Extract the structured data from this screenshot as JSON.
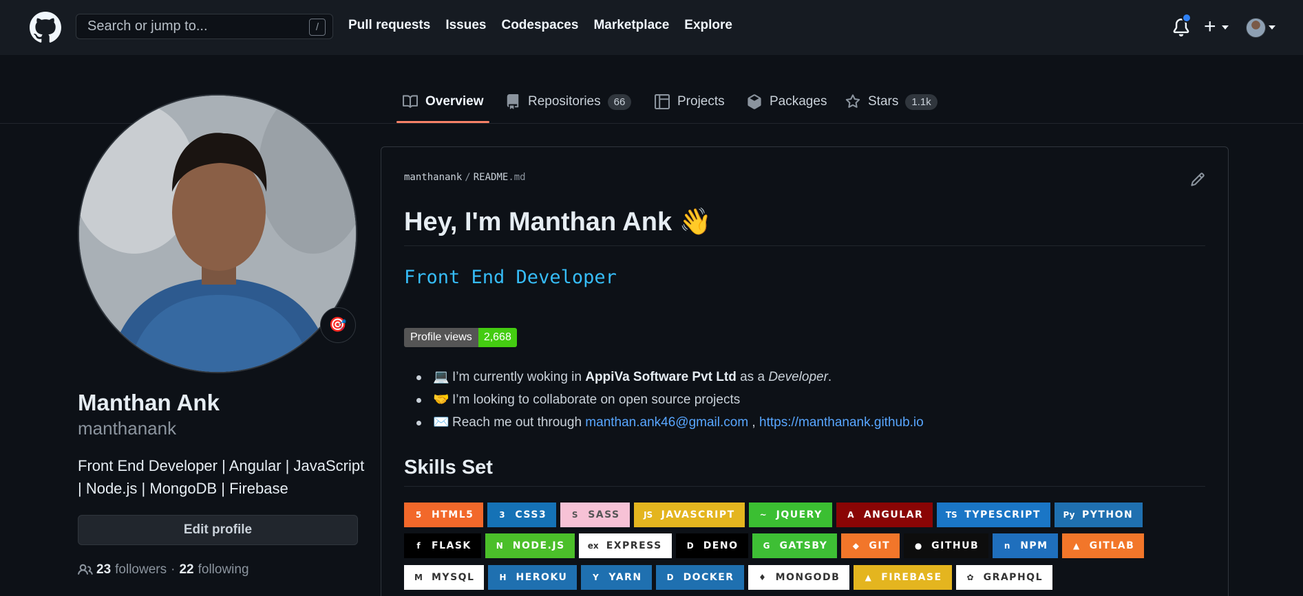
{
  "header": {
    "search_placeholder": "Search or jump to...",
    "search_shortcut": "/",
    "nav": [
      "Pull requests",
      "Issues",
      "Codespaces",
      "Marketplace",
      "Explore"
    ],
    "plus": "+"
  },
  "tabs": {
    "overview": "Overview",
    "repositories": "Repositories",
    "repositories_count": "66",
    "projects": "Projects",
    "packages": "Packages",
    "stars": "Stars",
    "stars_count": "1.1k"
  },
  "profile": {
    "name": "Manthan Ank",
    "login": "manthanank",
    "bio": "Front End Developer | Angular | JavaScript | Node.js | MongoDB | Firebase",
    "edit_button": "Edit profile",
    "followers_count": "23",
    "followers_label": "followers",
    "separator": "·",
    "following_count": "22",
    "following_label": "following",
    "status_emoji": "🎯"
  },
  "readme": {
    "owner": "manthanank",
    "file_base": "README",
    "file_ext": ".md",
    "heading": "Hey, I'm Manthan Ank",
    "heading_emoji": "👋",
    "typing_text": "Front End Developer",
    "views_label": "Profile views",
    "views_value": "2,668",
    "bullet1_emoji": "💻",
    "bullet1_pre": "I’m currently woking in ",
    "bullet1_company": "AppiVa Software Pvt Ltd",
    "bullet1_mid": " as a ",
    "bullet1_role": "Developer",
    "bullet1_end": ".",
    "bullet2_emoji": "🤝",
    "bullet2_text": "I’m looking to collaborate on open source projects",
    "bullet3_emoji": "✉️",
    "bullet3_pre": "Reach me out through ",
    "bullet3_email": "manthan.ank46@gmail.com",
    "bullet3_sep": " , ",
    "bullet3_url": "https://manthanank.github.io",
    "skills_heading": "Skills Set"
  },
  "skills": {
    "row1": [
      {
        "label": "HTML5",
        "bg": "#f2682a",
        "fg": "#ffffff",
        "icon": "5"
      },
      {
        "label": "CSS3",
        "bg": "#1572b6",
        "fg": "#ffffff",
        "icon": "3"
      },
      {
        "label": "SASS",
        "bg": "#f7c2d6",
        "fg": "#555555",
        "icon": "S"
      },
      {
        "label": "JAVASCRIPT",
        "bg": "#e4b51f",
        "fg": "#ffffff",
        "icon": "JS"
      },
      {
        "label": "JQUERY",
        "bg": "#3bbf32",
        "fg": "#ffffff",
        "icon": "~"
      },
      {
        "label": "ANGULAR",
        "bg": "#8a0505",
        "fg": "#ffffff",
        "icon": "A"
      },
      {
        "label": "TYPESCRIPT",
        "bg": "#1a76c6",
        "fg": "#ffffff",
        "icon": "TS"
      },
      {
        "label": "PYTHON",
        "bg": "#1f70b0",
        "fg": "#ffffff",
        "icon": "Py"
      }
    ],
    "row2": [
      {
        "label": "FLASK",
        "bg": "#000000",
        "fg": "#ffffff",
        "icon": "f"
      },
      {
        "label": "NODE.JS",
        "bg": "#4bbf2a",
        "fg": "#ffffff",
        "icon": "N"
      },
      {
        "label": "EXPRESS",
        "bg": "#ffffff",
        "fg": "#333333",
        "icon": "ex"
      },
      {
        "label": "DENO",
        "bg": "#000000",
        "fg": "#ffffff",
        "icon": "D"
      },
      {
        "label": "GATSBY",
        "bg": "#3ebf35",
        "fg": "#ffffff",
        "icon": "G"
      },
      {
        "label": "GIT",
        "bg": "#f2762a",
        "fg": "#ffffff",
        "icon": "◆"
      },
      {
        "label": "GITHUB",
        "bg": "#0d0d0d",
        "fg": "#ffffff",
        "icon": "●"
      },
      {
        "label": "NPM",
        "bg": "#1f6fbd",
        "fg": "#ffffff",
        "icon": "n"
      },
      {
        "label": "GITLAB",
        "bg": "#f2762a",
        "fg": "#ffffff",
        "icon": "▲"
      }
    ],
    "row3": [
      {
        "label": "MYSQL",
        "bg": "#ffffff",
        "fg": "#333333",
        "icon": "M"
      },
      {
        "label": "HEROKU",
        "bg": "#1f70b0",
        "fg": "#ffffff",
        "icon": "H"
      },
      {
        "label": "YARN",
        "bg": "#1f70b0",
        "fg": "#ffffff",
        "icon": "Y"
      },
      {
        "label": "DOCKER",
        "bg": "#1f70b0",
        "fg": "#ffffff",
        "icon": "D"
      },
      {
        "label": "MONGODB",
        "bg": "#ffffff",
        "fg": "#333333",
        "icon": "♦"
      },
      {
        "label": "FIREBASE",
        "bg": "#e4b51f",
        "fg": "#ffffff",
        "icon": "▲"
      },
      {
        "label": "GRAPHQL",
        "bg": "#ffffff",
        "fg": "#333333",
        "icon": "✿"
      }
    ]
  }
}
